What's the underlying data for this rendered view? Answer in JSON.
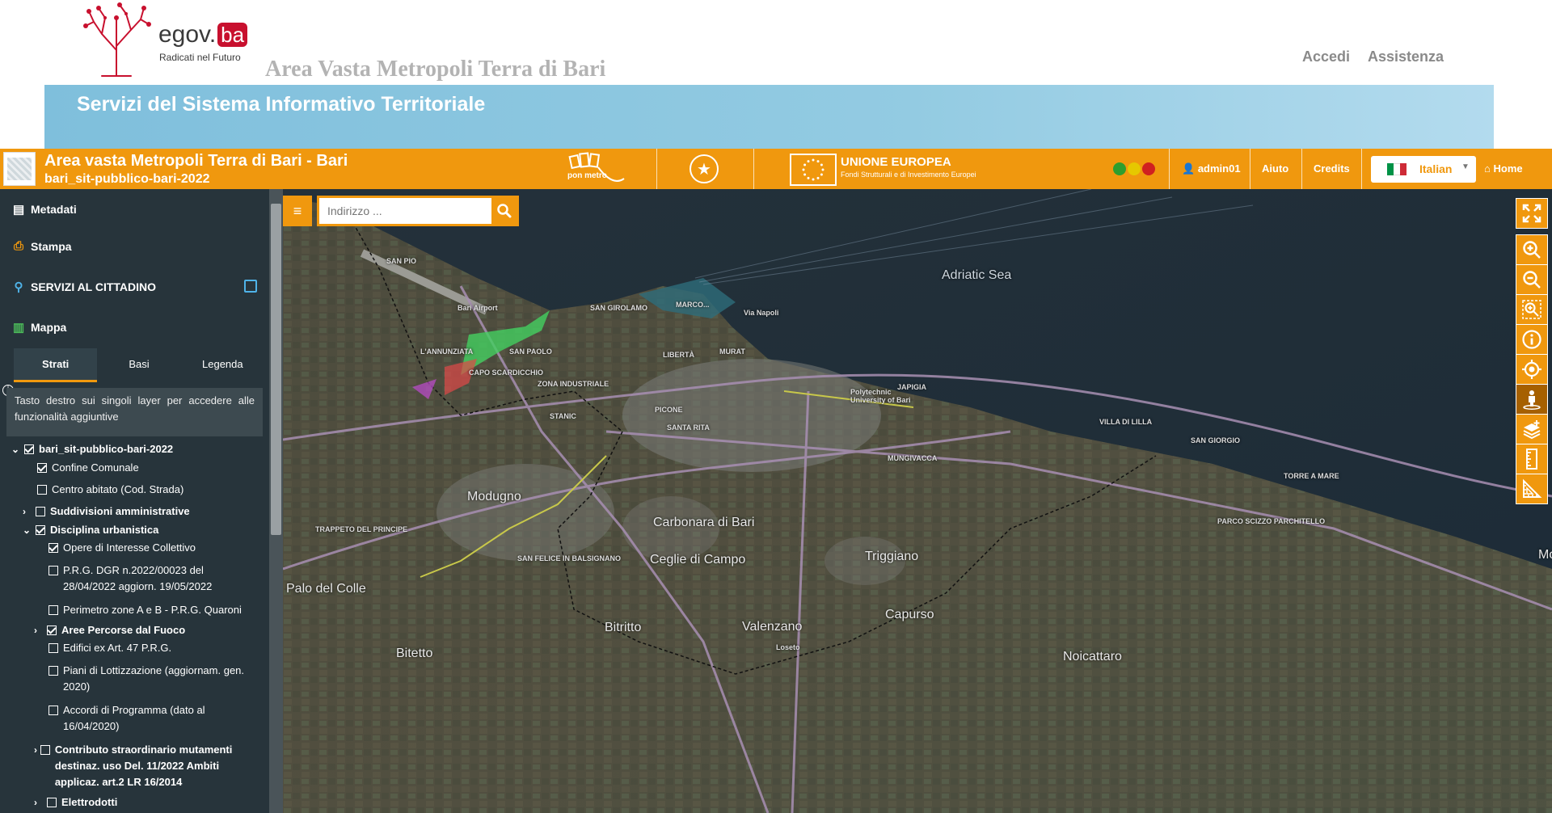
{
  "site": {
    "brand_name": "egov.",
    "brand_suffix": "ba",
    "tagline": "Radicati nel Futuro",
    "subtitle": "Area Vasta Metropoli Terra di Bari",
    "nav": {
      "login": "Accedi",
      "help": "Assistenza"
    },
    "banner_title": "Servizi del Sistema Informativo Territoriale"
  },
  "app_bar": {
    "title": "Area vasta Metropoli Terra di Bari - Bari",
    "subtitle": "bari_sit-pubblico-bari-2022",
    "pon_logo_text": "pon metro",
    "eu_title": "UNIONE EUROPEA",
    "eu_subtitle": "Fondi Strutturali e di Investimento Europei",
    "user": "admin01",
    "help": "Aiuto",
    "credits": "Credits",
    "language": "Italian",
    "home": "Home",
    "colors": {
      "bar": "#f0980e",
      "smiley_green": "#2e9e2e",
      "smiley_yellow": "#e6c800",
      "smiley_red": "#d02020"
    }
  },
  "sidebar": {
    "items": [
      {
        "label": "Metadati",
        "icon": "file-icon"
      },
      {
        "label": "Stampa",
        "icon": "printer-icon"
      },
      {
        "label": "SERVIZI AL CITTADINO",
        "icon": "search-icon"
      },
      {
        "label": "Mappa",
        "icon": "map-icon"
      }
    ],
    "tabs": [
      "Strati",
      "Basi",
      "Legenda"
    ],
    "active_tab": "Strati",
    "hint": "Tasto destro sui singoli layer per accedere alle funzionalità aggiuntive",
    "layers": [
      {
        "label": "bari_sit-pubblico-bari-2022",
        "checked": true,
        "expanded": true
      },
      {
        "label": "Confine Comunale",
        "checked": true
      },
      {
        "label": "Centro abitato (Cod. Strada)",
        "checked": false
      },
      {
        "label": "Suddivisioni amministrative",
        "checked": false,
        "expanded": false
      },
      {
        "label": "Disciplina urbanistica",
        "checked": true,
        "expanded": true
      },
      {
        "label": "Opere di Interesse Collettivo",
        "checked": true
      },
      {
        "label": "P.R.G. DGR n.2022/00023 del 28/04/2022 aggiorn. 19/05/2022",
        "checked": false
      },
      {
        "label": "Perimetro zone A e B - P.R.G. Quaroni",
        "checked": false
      },
      {
        "label": "Aree Percorse dal Fuoco",
        "checked": true,
        "expanded": false
      },
      {
        "label": "Edifici ex Art. 47 P.R.G.",
        "checked": false
      },
      {
        "label": "Piani di Lottizzazione (aggiornam. gen. 2020)",
        "checked": false
      },
      {
        "label": "Accordi di Programma (dato al 16/04/2020)",
        "checked": false
      },
      {
        "label": "Contributo straordinario mutamenti destinaz. uso Del. 11/2022 Ambiti applicaz. art.2 LR 16/2014",
        "checked": false,
        "expanded": false
      },
      {
        "label": "Elettrodotti",
        "checked": false,
        "expanded": false
      }
    ]
  },
  "map": {
    "search_placeholder": "Indirizzo ...",
    "labels": {
      "sea": "Adriatic Sea",
      "modugno": "Modugno",
      "carbonara": "Carbonara di Bari",
      "ceglie": "Ceglie di Campo",
      "triggiano": "Triggiano",
      "palo": "Palo del Colle",
      "valenzano": "Valenzano",
      "bitritto": "Bitritto",
      "capurso": "Capurso",
      "noicattaro": "Noicattaro",
      "bitetto": "Bitetto",
      "mola": "Mol",
      "murat": "MURAT",
      "liberta": "LIBERTÀ",
      "japigia": "JAPIGIA",
      "picone": "PICONE",
      "stanic": "STANIC",
      "san_paolo": "SAN PAOLO",
      "annunziata": "L'ANNUNZIATA",
      "san_pio": "SAN PIO",
      "capo_scardicchio": "CAPO SCARDICCHIO",
      "zona_industriale": "ZONA INDUSTRIALE",
      "santa_rita": "SANTA RITA",
      "san_girolamo": "SAN GIROLAMO",
      "marconi": "MARCO...",
      "villa_lilla": "VILLA DI LILLA",
      "san_giorgio": "SAN GIORGIO",
      "torre_mare": "TORRE A MARE",
      "parco": "PARCO SCIZZO PARCHITELLO",
      "san_felice": "SAN FELICE IN BALSIGNANO",
      "trappeto": "TRAPPETO DEL PRINCIPE",
      "mungivacca": "MUNGIVACCA",
      "bari_airport": "Bari Airport",
      "poly": "Polytechnic University of Bari",
      "via_napoli": "Via Napoli",
      "losteo": "Loseto"
    },
    "tools": [
      "fullscreen-icon",
      "zoom-in-icon",
      "zoom-out-icon",
      "zoom-box-icon",
      "info-icon",
      "locate-icon",
      "streetview-icon",
      "add-layer-icon",
      "measure-line-icon",
      "measure-area-icon"
    ]
  }
}
